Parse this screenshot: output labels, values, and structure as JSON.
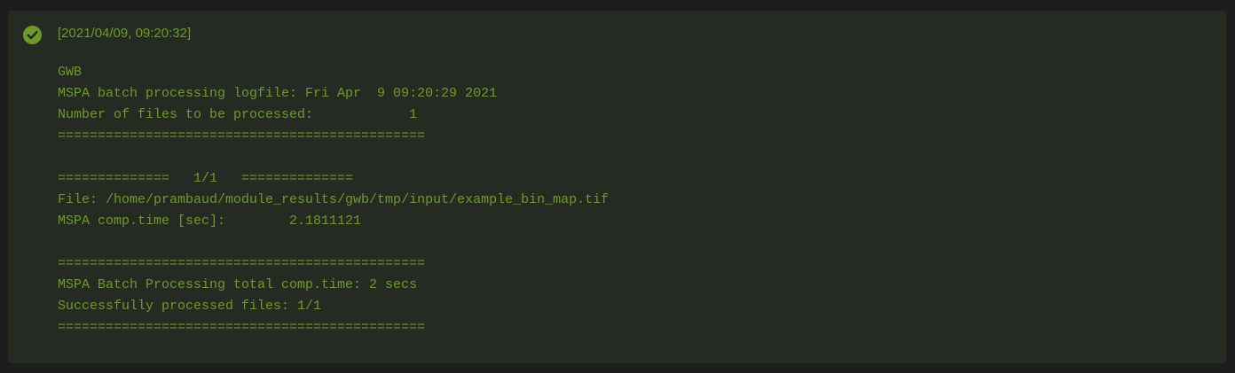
{
  "alert": {
    "icon": "check-circle-icon",
    "status_color": "#6e9a2c",
    "timestamp": "[2021/04/09, 09:20:32]",
    "log_lines": [
      "GWB",
      "MSPA batch processing logfile: Fri Apr  9 09:20:29 2021",
      "Number of files to be processed:            1",
      "==============================================",
      "",
      "==============   1/1   ==============",
      "File: /home/prambaud/module_results/gwb/tmp/input/example_bin_map.tif",
      "MSPA comp.time [sec]:        2.1811121",
      "",
      "==============================================",
      "MSPA Batch Processing total comp.time: 2 secs",
      "Successfully processed files: 1/1",
      "=============================================="
    ]
  }
}
